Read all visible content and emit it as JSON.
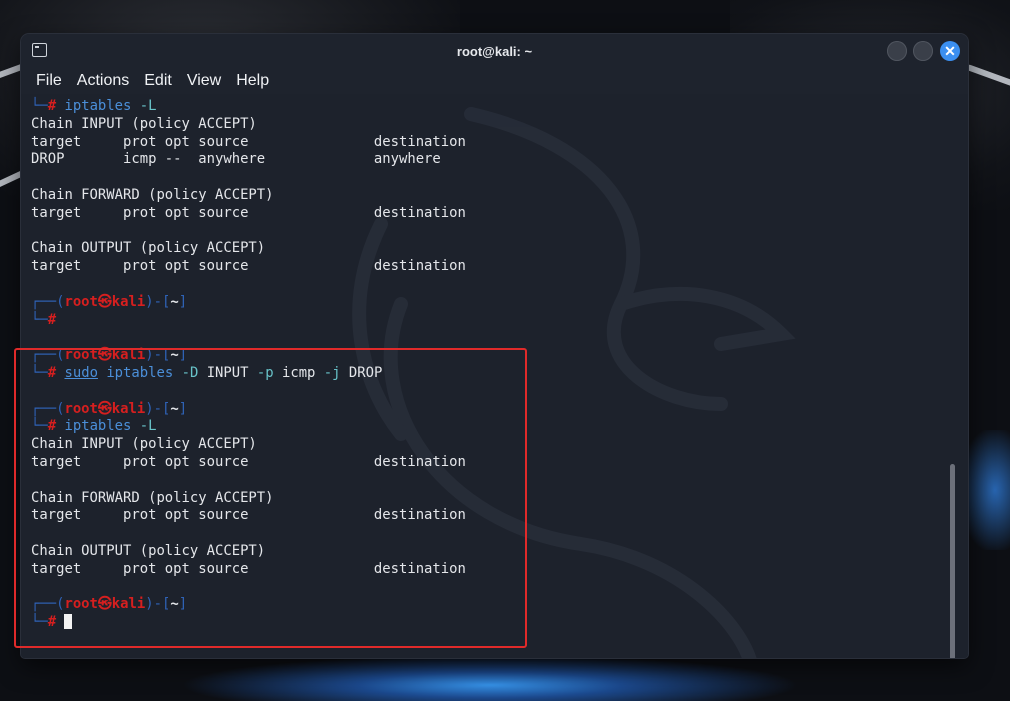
{
  "window": {
    "title": "root@kali: ~"
  },
  "menu": [
    "File",
    "Actions",
    "Edit",
    "View",
    "Help"
  ],
  "prompt": {
    "user": "root",
    "host": "kali",
    "dir": "~",
    "symbol": "#",
    "at_glyph": "㉿"
  },
  "lines": [
    {
      "kind": "cmd",
      "text": "iptables -L"
    },
    {
      "kind": "out",
      "text": "Chain INPUT (policy ACCEPT)"
    },
    {
      "kind": "out",
      "text": "target     prot opt source               destination"
    },
    {
      "kind": "out",
      "text": "DROP       icmp --  anywhere             anywhere"
    },
    {
      "kind": "blank"
    },
    {
      "kind": "out",
      "text": "Chain FORWARD (policy ACCEPT)"
    },
    {
      "kind": "out",
      "text": "target     prot opt source               destination"
    },
    {
      "kind": "blank"
    },
    {
      "kind": "out",
      "text": "Chain OUTPUT (policy ACCEPT)"
    },
    {
      "kind": "out",
      "text": "target     prot opt source               destination"
    },
    {
      "kind": "blank"
    },
    {
      "kind": "prompt"
    },
    {
      "kind": "cmd",
      "text": ""
    },
    {
      "kind": "blank"
    },
    {
      "kind": "prompt"
    },
    {
      "kind": "cmd",
      "text": "sudo iptables -D INPUT -p icmp -j DROP"
    },
    {
      "kind": "blank"
    },
    {
      "kind": "prompt"
    },
    {
      "kind": "cmd",
      "text": "iptables -L"
    },
    {
      "kind": "out",
      "text": "Chain INPUT (policy ACCEPT)"
    },
    {
      "kind": "out",
      "text": "target     prot opt source               destination"
    },
    {
      "kind": "blank"
    },
    {
      "kind": "out",
      "text": "Chain FORWARD (policy ACCEPT)"
    },
    {
      "kind": "out",
      "text": "target     prot opt source               destination"
    },
    {
      "kind": "blank"
    },
    {
      "kind": "out",
      "text": "Chain OUTPUT (policy ACCEPT)"
    },
    {
      "kind": "out",
      "text": "target     prot opt source               destination"
    },
    {
      "kind": "blank"
    },
    {
      "kind": "prompt"
    },
    {
      "kind": "cmd",
      "text": "",
      "cursor": true
    }
  ],
  "colors": {
    "prompt_box": "#2f63b8",
    "prompt_user": "#d61f1f",
    "command": "#4b8fd9",
    "option": "#68c3c9",
    "highlight": "#e02a2a",
    "close_button": "#3b8ff0"
  },
  "icons": [
    "terminal-icon",
    "minimize-icon",
    "maximize-icon",
    "close-icon"
  ]
}
